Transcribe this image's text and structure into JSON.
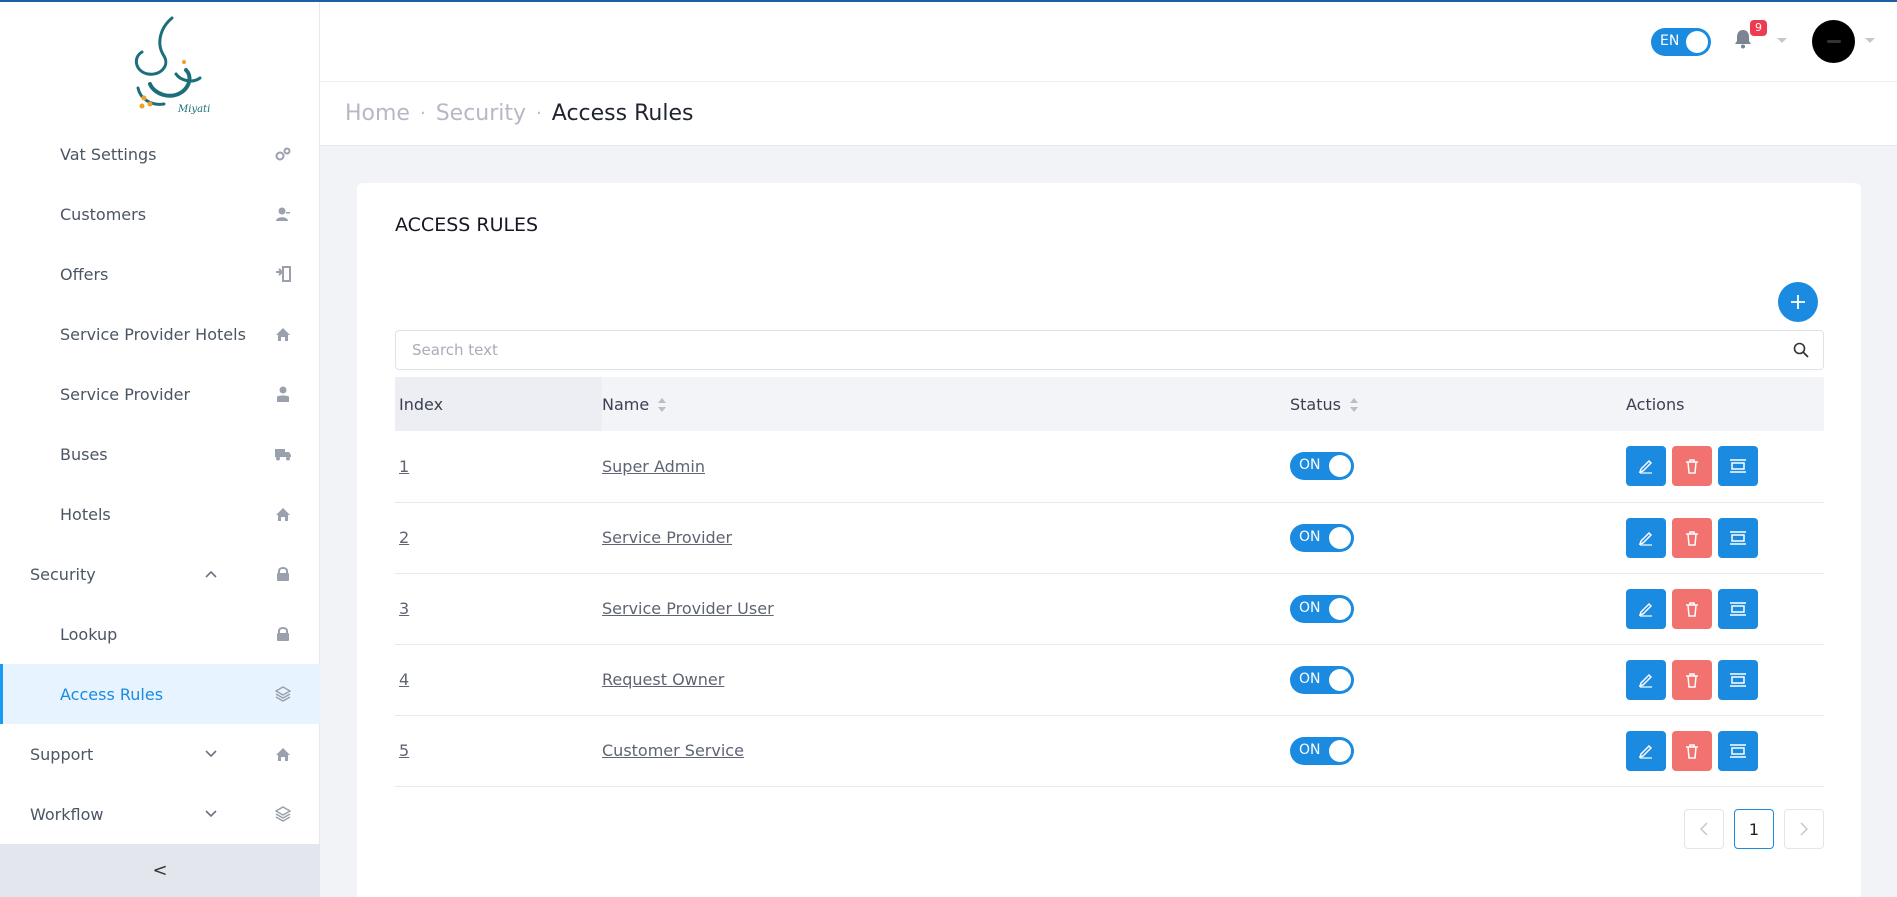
{
  "app": {
    "logo_text": "Miyati"
  },
  "sidebar": {
    "items": [
      {
        "label": "Vat Settings",
        "icon": "gears-icon"
      },
      {
        "label": "Customers",
        "icon": "user-icon"
      },
      {
        "label": "Offers",
        "icon": "offers-icon"
      },
      {
        "label": "Service Provider Hotels",
        "icon": "home-icon"
      },
      {
        "label": "Service Provider",
        "icon": "user-tie-icon"
      },
      {
        "label": "Buses",
        "icon": "truck-icon"
      },
      {
        "label": "Hotels",
        "icon": "home-icon"
      },
      {
        "label": "Security",
        "icon": "lock-icon",
        "expanded": true
      },
      {
        "label": "Lookup",
        "icon": "lock-icon"
      },
      {
        "label": "Access Rules",
        "icon": "layers-icon",
        "active": true
      },
      {
        "label": "Support",
        "icon": "home-icon",
        "expanded": false
      },
      {
        "label": "Workflow",
        "icon": "layers-icon",
        "expanded": false
      }
    ],
    "collapse_glyph": "<"
  },
  "header": {
    "lang_toggle": "EN",
    "notification_count": "9"
  },
  "breadcrumb": {
    "home": "Home",
    "section": "Security",
    "current": "Access Rules",
    "separator": "·"
  },
  "main": {
    "card_title": "ACCESS RULES",
    "search_placeholder": "Search text",
    "columns": {
      "index": "Index",
      "name": "Name",
      "status": "Status",
      "actions": "Actions"
    },
    "rows": [
      {
        "index": "1",
        "name": "Super Admin",
        "status": "ON"
      },
      {
        "index": "2",
        "name": "Service Provider",
        "status": "ON"
      },
      {
        "index": "3",
        "name": "Service Provider User",
        "status": "ON"
      },
      {
        "index": "4",
        "name": "Request Owner",
        "status": "ON"
      },
      {
        "index": "5",
        "name": "Customer Service",
        "status": "ON"
      }
    ],
    "pagination": {
      "current_page": "1"
    }
  },
  "colors": {
    "accent": "#1a8be0",
    "danger": "#f1726e",
    "active_bg": "#e7f4ff",
    "badge": "#ef3b4f",
    "top_line": "#1b5fa8"
  }
}
